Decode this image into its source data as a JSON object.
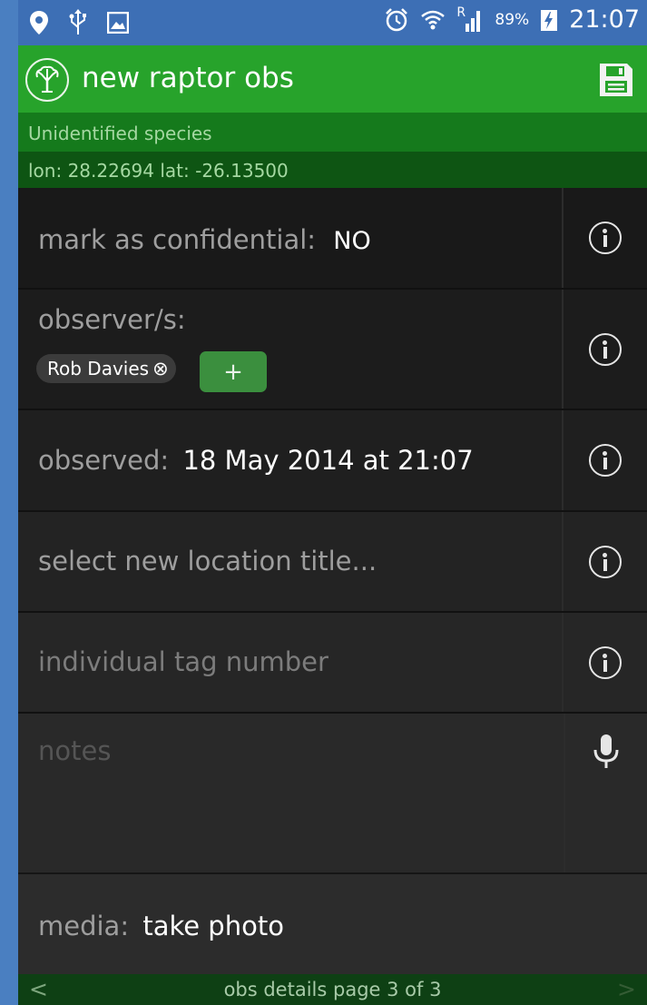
{
  "status_bar": {
    "icons_left": [
      "location-pin-icon",
      "usb-icon",
      "image-icon"
    ],
    "icons_right": [
      "alarm-icon",
      "wifi-icon",
      "signal-icon",
      "battery-charging-icon"
    ],
    "roaming": "R",
    "battery": "89%",
    "time": "21:07"
  },
  "action_bar": {
    "title": "new raptor obs",
    "logo_icon": "tree-logo-icon",
    "save_icon": "save-icon"
  },
  "species_bar": {
    "text": "Unidentified species"
  },
  "coords_bar": {
    "text": "lon: 28.22694  lat: -26.13500"
  },
  "rows": {
    "confidential": {
      "label": "mark as confidential:",
      "value": "NO"
    },
    "observers": {
      "label": "observer/s:",
      "chip": "Rob Davies",
      "chip_remove": "⊗",
      "add_label": "+"
    },
    "observed": {
      "label": "observed:",
      "value": "18 May 2014 at 21:07"
    },
    "location": {
      "placeholder": "select new location title..."
    },
    "tag": {
      "placeholder": "individual tag number"
    },
    "notes": {
      "placeholder": "notes",
      "icon": "microphone-icon"
    },
    "media": {
      "label": "media:",
      "value": "take photo"
    }
  },
  "footer": {
    "prev": "<",
    "label": "obs details page 3 of 3",
    "next": ">"
  },
  "colors": {
    "action_bar": "#27a32b",
    "species_bar": "#157a1c",
    "coords_bar": "#0e5513",
    "background": "#4a7fc1"
  }
}
